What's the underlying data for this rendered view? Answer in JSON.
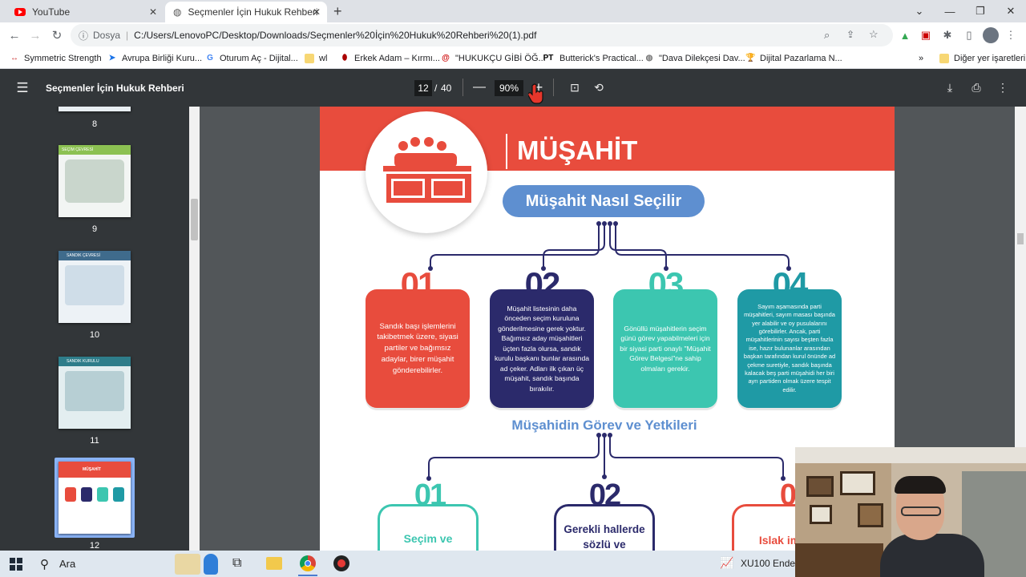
{
  "tabs": [
    {
      "title": "YouTube",
      "icon": "youtube-icon"
    },
    {
      "title": "Seçmenler İçin Hukuk Rehberi",
      "icon": "globe-icon"
    }
  ],
  "address": {
    "prefix": "Dosya",
    "url": "C:/Users/LenovoPC/Desktop/Downloads/Seçmenler%20İçin%20Hukuk%20Rehberi%20(1).pdf"
  },
  "bookmarks": [
    "Symmetric Strength",
    "Avrupa Birliği Kuru...",
    "Oturum Aç - Dijital...",
    "wl",
    "Erkek Adam – Kırmı...",
    "\"HUKUKÇU GİBİ ÖĞ...",
    "Butterick's Practical...",
    "\"Dava Dilekçesi Dav...",
    "Dijital Pazarlama N..."
  ],
  "bookmarks_overflow": "»",
  "other_bookmarks": "Diğer yer işaretleri",
  "pdf": {
    "title": "Seçmenler İçin Hukuk Rehberi",
    "page_current": "12",
    "page_sep": "/",
    "page_total": "40",
    "zoom": "90%"
  },
  "thumbnails": [
    {
      "label": "8"
    },
    {
      "label": "9",
      "heading": "SEÇİM ÇEVRESİ"
    },
    {
      "label": "10",
      "heading": "SANDIK ÇEVRESİ"
    },
    {
      "label": "11",
      "heading": "SANDIK KURULU"
    },
    {
      "label": "12",
      "heading": "MÜŞAHİT"
    }
  ],
  "page_content": {
    "banner_title": "MÜŞAHİT",
    "section1_title": "Müşahit Nasıl Seçilir",
    "cards": [
      {
        "num": "01",
        "text": "Sandık başı işlemlerini takibetmek üzere, siyasi partiler ve bağımsız adaylar, birer müşahit gönderebilirler."
      },
      {
        "num": "02",
        "text": "Müşahit listesinin daha önceden seçim kuruluna gönderilmesine gerek yoktur. Bağımsız aday müşahitleri üçten fazla olursa, sandık kurulu başkanı bunlar arasında ad çeker. Adları ilk çıkan üç müşahit, sandık başında bırakılır."
      },
      {
        "num": "03",
        "text": "Gönüllü müşahitlerin seçim günü görev yapabilmeleri için bir siyasi parti onaylı \"Müşahit Görev Belgesi\"ne sahip olmaları gerekir."
      },
      {
        "num": "04",
        "text": "Sayım aşamasında parti müşahitleri, sayım masası başında yer alabilir ve oy pusulalarını görebilirler. Ancak, parti müşahitlerinin sayısı beşten fazla ise, hazır bulunanlar arasından başkan tarafından kurul önünde ad çekme suretiyle, sandık başında kalacak beş parti müşahidi her biri ayrı partiden olmak üzere tespit edilir."
      }
    ],
    "section2_title": "Müşahidin Görev ve Yetkileri",
    "duties": [
      {
        "num": "01",
        "text": "Seçim ve"
      },
      {
        "num": "02",
        "text": "Gerekli hallerde sözlü ve"
      },
      {
        "num": "03",
        "text": "Islak imz"
      }
    ]
  },
  "taskbar": {
    "search": "Ara",
    "stock": "XU100 Endek"
  },
  "colors": {
    "red": "#e84c3d",
    "navy": "#2b2a6b",
    "teal": "#3cc6b0",
    "darkteal": "#1f9aa5",
    "blue": "#5e8fd0"
  }
}
